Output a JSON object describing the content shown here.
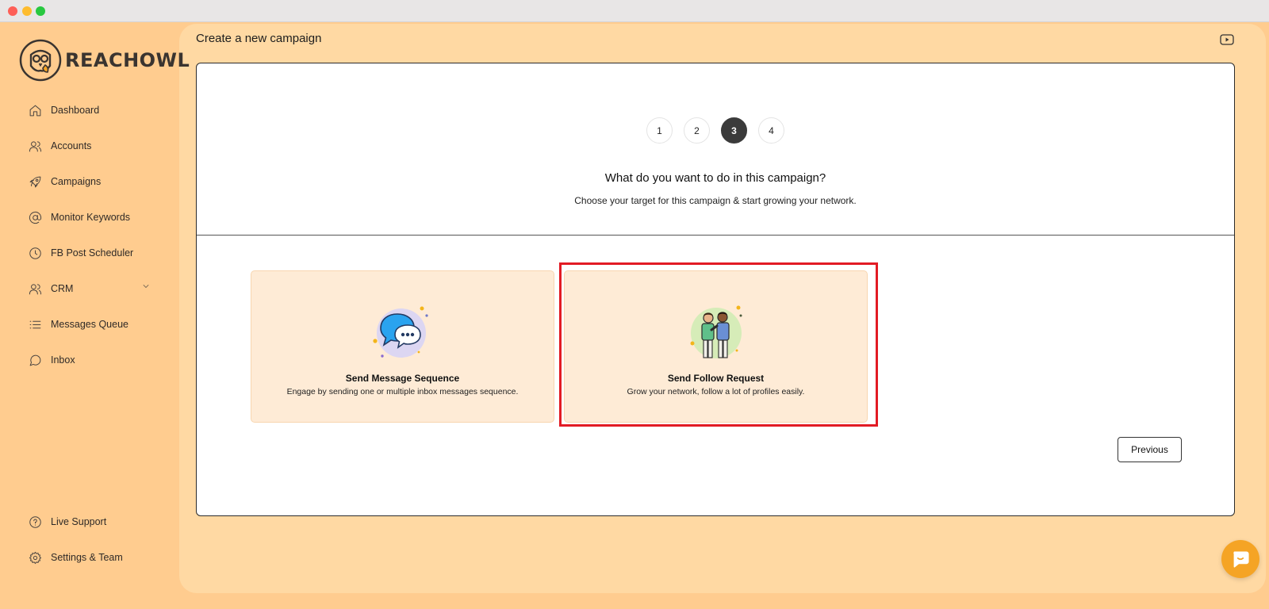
{
  "window": {
    "traffic_lights": [
      "close",
      "minimize",
      "zoom"
    ]
  },
  "brand": {
    "name": "REACHOWL",
    "logo_icon": "owl-icon"
  },
  "sidebar": {
    "items": [
      {
        "label": "Dashboard",
        "icon": "home-icon"
      },
      {
        "label": "Accounts",
        "icon": "users-icon"
      },
      {
        "label": "Campaigns",
        "icon": "rocket-icon"
      },
      {
        "label": "Monitor Keywords",
        "icon": "at-sign-icon"
      },
      {
        "label": "FB Post Scheduler",
        "icon": "clock-icon"
      },
      {
        "label": "CRM",
        "icon": "users-icon",
        "expandable": true
      },
      {
        "label": "Messages Queue",
        "icon": "list-icon"
      },
      {
        "label": "Inbox",
        "icon": "message-circle-icon"
      }
    ],
    "bottom_items": [
      {
        "label": "Live Support",
        "icon": "help-circle-icon"
      },
      {
        "label": "Settings & Team",
        "icon": "settings-icon"
      }
    ]
  },
  "header": {
    "title": "Create a new campaign",
    "video_icon": "youtube-icon"
  },
  "wizard": {
    "steps": [
      "1",
      "2",
      "3",
      "4"
    ],
    "active_step": "3",
    "question": "What do you want to do in this campaign?",
    "subtitle": "Choose your target for this campaign & start growing your network.",
    "options": [
      {
        "title": "Send Message Sequence",
        "description": "Engage by sending one or multiple inbox messages sequence.",
        "icon": "chat-bubbles-icon"
      },
      {
        "title": "Send Follow Request",
        "description": "Grow your network, follow a lot of profiles easily.",
        "icon": "two-people-icon",
        "highlighted": true
      }
    ],
    "previous_label": "Previous"
  },
  "colors": {
    "sidebar_bg": "#ffcc8f",
    "main_bg": "#ffd9a3",
    "option_bg": "#feebd6",
    "highlight": "#e21b24",
    "active_step": "#3b3b3b",
    "chat_button": "#f5a425"
  },
  "chat_widget": {
    "icon": "chat-icon"
  }
}
